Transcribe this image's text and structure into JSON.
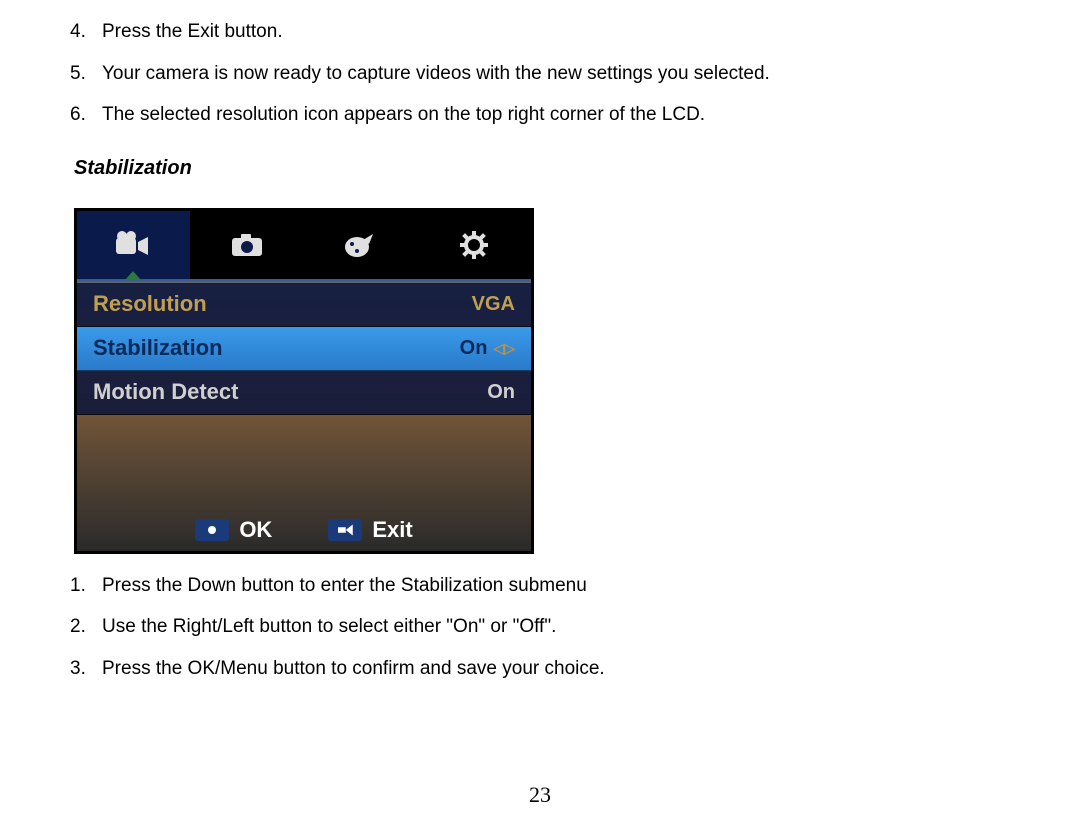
{
  "instructions_top": [
    {
      "num": "4.",
      "text": "Press the Exit button."
    },
    {
      "num": "5.",
      "text": "Your camera is now ready to capture videos with the new settings you selected."
    },
    {
      "num": "6.",
      "text": "The selected resolution icon appears on the top right corner of the LCD."
    }
  ],
  "section_heading": "Stabilization",
  "lcd": {
    "tabs": [
      {
        "icon": "video-icon",
        "active": true
      },
      {
        "icon": "camera-icon",
        "active": false
      },
      {
        "icon": "palette-icon",
        "active": false
      },
      {
        "icon": "gear-icon",
        "active": false
      }
    ],
    "rows": [
      {
        "label": "Resolution",
        "value": "VGA",
        "state": "dim"
      },
      {
        "label": "Stabilization",
        "value": "On",
        "state": "selected",
        "has_arrows": true
      },
      {
        "label": "Motion Detect",
        "value": "On",
        "state": "normal"
      }
    ],
    "footer": {
      "ok": "OK",
      "exit": "Exit"
    }
  },
  "instructions_bottom": [
    {
      "num": "1.",
      "text": "Press the Down button to enter the Stabilization submenu"
    },
    {
      "num": "2.",
      "text": "Use the Right/Left button to select either \"On\" or \"Off\"."
    },
    {
      "num": "3.",
      "text": "Press the OK/Menu button to confirm and save your choice."
    }
  ],
  "page_number": "23"
}
